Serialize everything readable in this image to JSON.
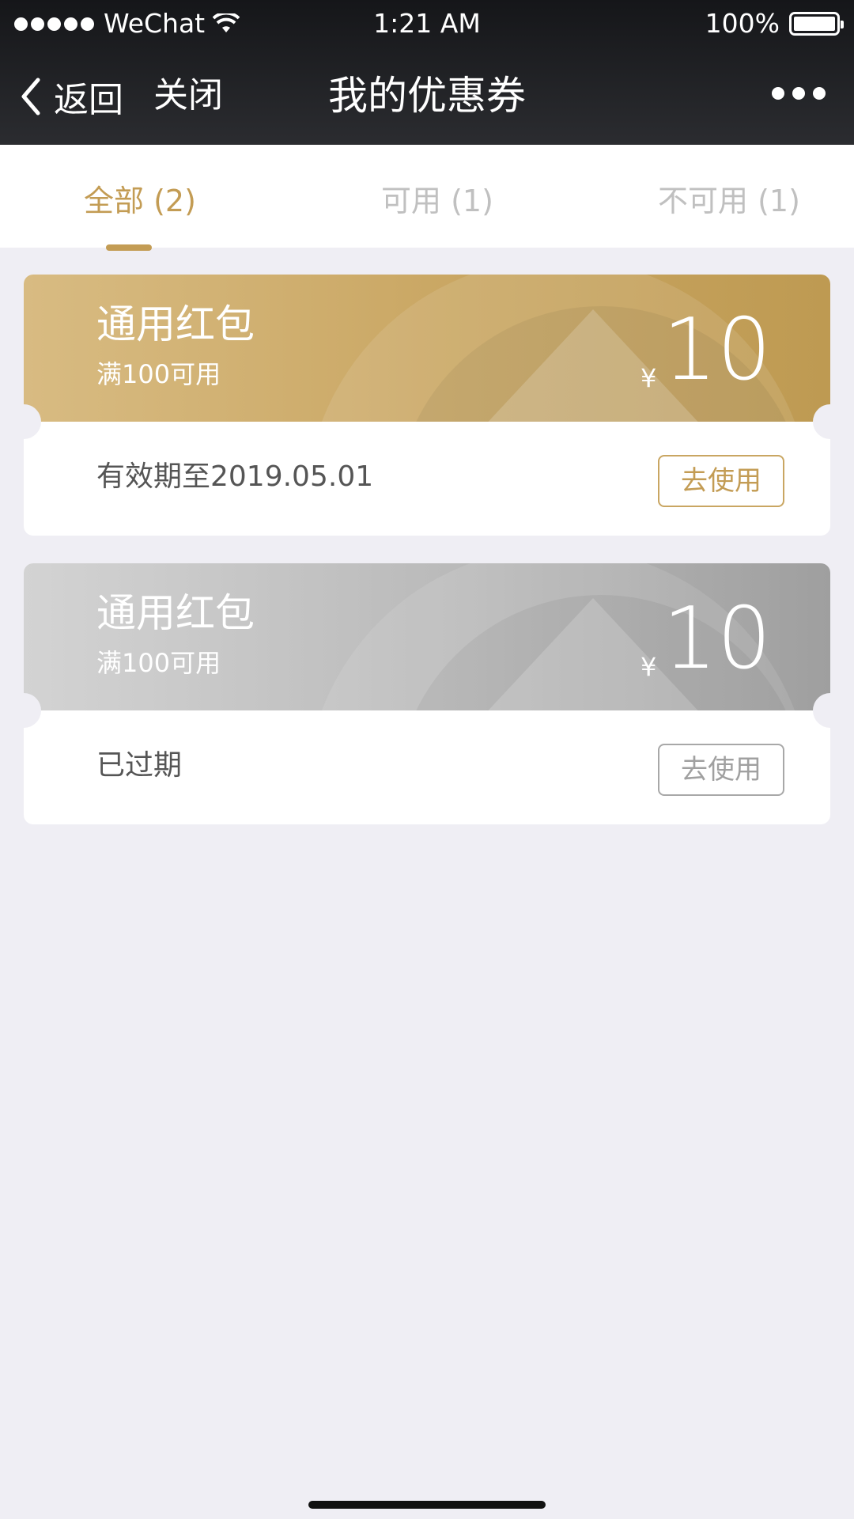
{
  "status_bar": {
    "carrier": "WeChat",
    "time": "1:21 AM",
    "battery": "100%"
  },
  "nav": {
    "back_label": "返回",
    "close_label": "关闭",
    "title": "我的优惠券"
  },
  "tabs": [
    {
      "label": "全部 (2)",
      "active": true
    },
    {
      "label": "可用 (1)",
      "active": false
    },
    {
      "label": "不可用 (1)",
      "active": false
    }
  ],
  "coupons": [
    {
      "name": "通用红包",
      "condition": "满100可用",
      "currency": "¥",
      "amount": "10",
      "validity": "有效期至2019.05.01",
      "action": "去使用",
      "style": "gold"
    },
    {
      "name": "通用红包",
      "condition": "满100可用",
      "currency": "¥",
      "amount": "10",
      "validity": "已过期",
      "action": "去使用",
      "style": "grey"
    }
  ],
  "colors": {
    "accent": "#c39c54",
    "background": "#efeef4",
    "header": "#1d1e21"
  }
}
